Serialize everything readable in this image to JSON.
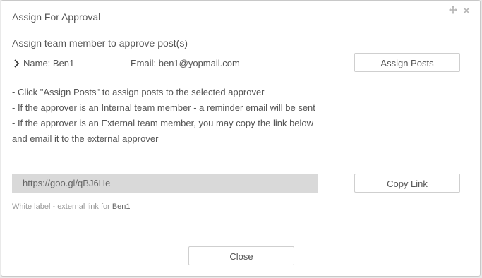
{
  "dialog": {
    "title": "Assign For Approval",
    "move_icon": "move-icon",
    "close_icon": "close-icon"
  },
  "section": {
    "subtitle": "Assign team member to approve post(s)"
  },
  "member": {
    "name_label": "Name: Ben1",
    "email_label": "Email: ben1@yopmail.com",
    "expand_icon": "chevron-right-icon"
  },
  "buttons": {
    "assign_posts": "Assign Posts",
    "copy_link": "Copy Link",
    "close": "Close"
  },
  "instructions": [
    "- Click \"Assign Posts\" to assign posts to the selected approver",
    "- If the approver is an Internal team member - a reminder email will be sent",
    "- If the approver is an External team member, you may copy the link below",
    "and email it to the external approver"
  ],
  "link": {
    "value": "https://goo.gl/qBJ6He"
  },
  "whitelabel": {
    "prefix": "White label - external link for ",
    "name": "Ben1"
  }
}
